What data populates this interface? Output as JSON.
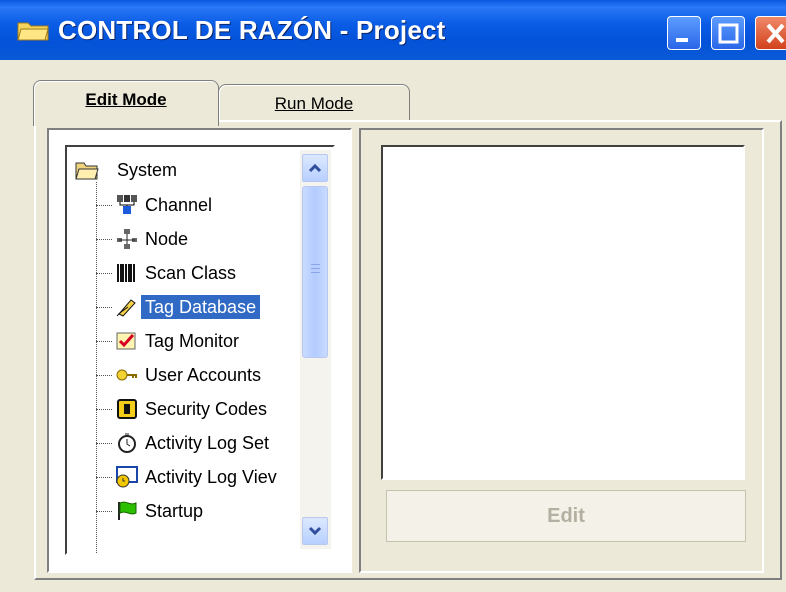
{
  "window": {
    "title": "CONTROL DE RAZÓN - Project"
  },
  "tabs": [
    {
      "label": "Edit Mode",
      "selected": true
    },
    {
      "label": "Run Mode",
      "selected": false
    }
  ],
  "tree": {
    "root": {
      "label": "System",
      "icon": "open-folder-icon"
    },
    "items": [
      {
        "label": "Channel",
        "icon": "network-channel-icon"
      },
      {
        "label": "Node",
        "icon": "node-network-icon"
      },
      {
        "label": "Scan Class",
        "icon": "barcode-icon"
      },
      {
        "label": "Tag Database",
        "icon": "tag-database-icon",
        "selected": true
      },
      {
        "label": "Tag Monitor",
        "icon": "checklist-icon"
      },
      {
        "label": "User Accounts",
        "icon": "key-icon"
      },
      {
        "label": "Security Codes",
        "icon": "security-lock-icon"
      },
      {
        "label": "Activity Log Set",
        "icon": "stopwatch-icon"
      },
      {
        "label": "Activity Log Viev",
        "icon": "log-viewer-icon"
      },
      {
        "label": "Startup",
        "icon": "startup-flag-icon"
      }
    ]
  },
  "buttons": {
    "edit_label": "Edit"
  },
  "colors": {
    "selection": "#316ac5",
    "titlebar": "#0a5ce6",
    "background": "#ece9d8"
  }
}
